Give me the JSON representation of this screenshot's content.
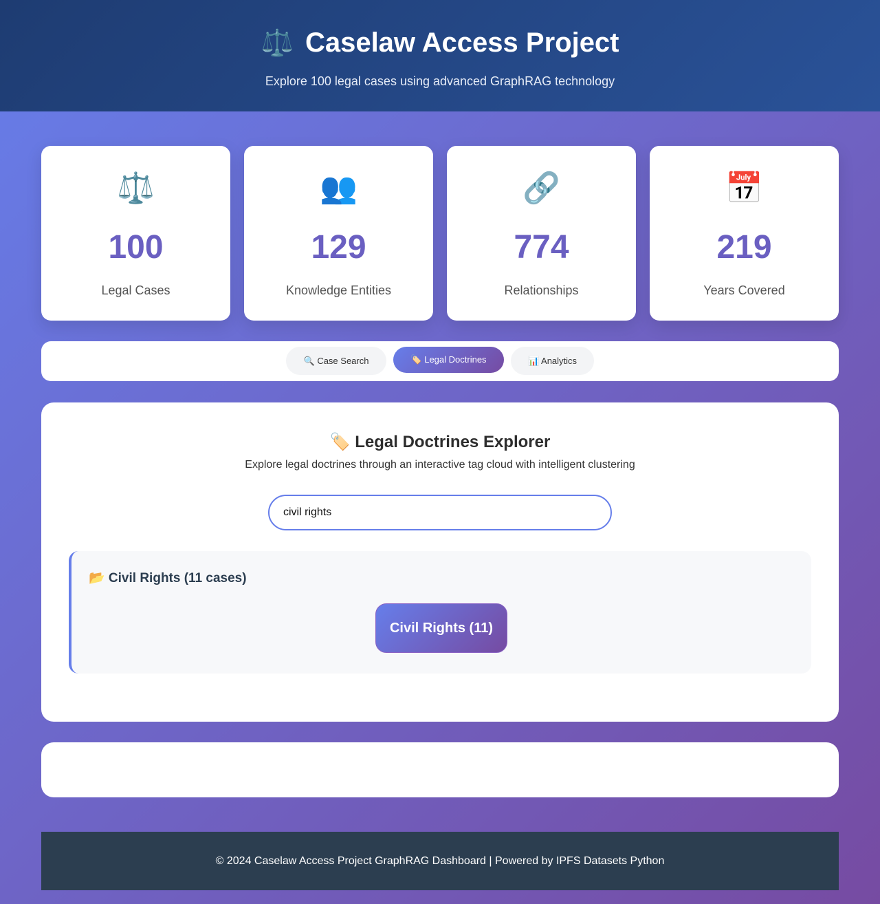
{
  "header": {
    "logo_icon": "⚖️",
    "title": "Caselaw Access Project",
    "subtitle": "Explore 100 legal cases using advanced GraphRAG technology"
  },
  "stats": [
    {
      "icon": "⚖️",
      "value": "100",
      "label": "Legal Cases"
    },
    {
      "icon": "👥",
      "value": "129",
      "label": "Knowledge Entities"
    },
    {
      "icon": "🔗",
      "value": "774",
      "label": "Relationships"
    },
    {
      "icon": "📅",
      "value": "219",
      "label": "Years Covered"
    }
  ],
  "tabs": [
    {
      "label": "🔍 Case Search",
      "active": false
    },
    {
      "label": "🏷️ Legal Doctrines",
      "active": true
    },
    {
      "label": "📊 Analytics",
      "active": false
    }
  ],
  "doctrines": {
    "title": "🏷️ Legal Doctrines Explorer",
    "description": "Explore legal doctrines through an interactive tag cloud with intelligent clustering",
    "search_value": "civil rights",
    "cluster": {
      "title": "📂 Civil Rights (11 cases)",
      "tags": [
        {
          "label": "Civil Rights (11)"
        }
      ]
    }
  },
  "footer": {
    "text": "© 2024 Caselaw Access Project GraphRAG Dashboard | Powered by IPFS Datasets Python"
  },
  "colors": {
    "accent": "#667eea",
    "accent_end": "#764ba2",
    "header_start": "#1e3c72",
    "header_end": "#2a5298",
    "stat_number": "#6a5fc1",
    "footer_bg": "#2c3e50"
  }
}
